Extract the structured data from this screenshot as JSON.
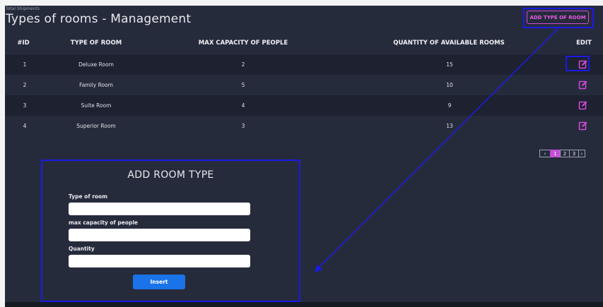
{
  "header": {
    "subtitle": "Total Shipments",
    "title": "Types of rooms - Management",
    "add_button_label": "ADD TYPE OF ROOM"
  },
  "table": {
    "columns": [
      "#ID",
      "TYPE OF ROOM",
      "MAX CAPACITY OF PEOPLE",
      "QUANTITY OF AVAILABLE ROOMS",
      "EDIT"
    ],
    "rows": [
      {
        "id": "1",
        "type": "Deluxe Room",
        "capacity": "2",
        "quantity": "15"
      },
      {
        "id": "2",
        "type": "Family Room",
        "capacity": "5",
        "quantity": "10"
      },
      {
        "id": "3",
        "type": "Suite Room",
        "capacity": "4",
        "quantity": "9"
      },
      {
        "id": "4",
        "type": "Superior Room",
        "capacity": "3",
        "quantity": "13"
      }
    ],
    "edit_icon": "edit-icon"
  },
  "pagination": {
    "prev": "‹",
    "pages": [
      "1",
      "2",
      "3"
    ],
    "active": "1",
    "next": "›"
  },
  "form": {
    "title": "ADD ROOM TYPE",
    "type_label": "Type of room",
    "type_value": "",
    "capacity_label": "max capacity of people",
    "capacity_value": "",
    "quantity_label": "Quantity",
    "quantity_value": "",
    "submit_label": "Insert"
  },
  "colors": {
    "panel": "#262b3c",
    "row_alt": "#1d2130",
    "accent": "#d14ad9",
    "highlight": "#1a1ae6",
    "button": "#1a73e8"
  }
}
